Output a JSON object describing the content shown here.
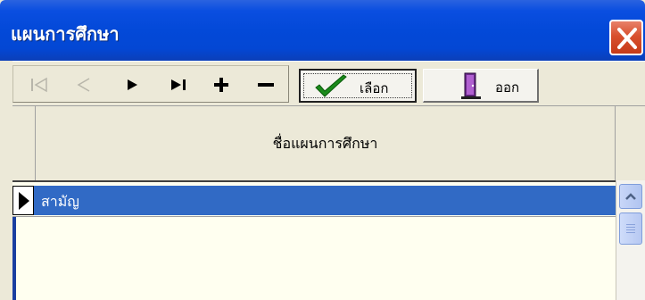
{
  "window": {
    "title": "แผนการศึกษา"
  },
  "toolbar": {
    "nav_buttons": [
      {
        "name": "first-record",
        "enabled": false
      },
      {
        "name": "prior-record",
        "enabled": false
      },
      {
        "name": "next-record",
        "enabled": true
      },
      {
        "name": "last-record",
        "enabled": true
      },
      {
        "name": "insert-record",
        "enabled": true
      },
      {
        "name": "delete-record",
        "enabled": true
      }
    ],
    "select_label": "เลือก",
    "exit_label": "ออก"
  },
  "grid": {
    "columns": [
      "ชื่อแผนการศึกษา"
    ],
    "rows": [
      {
        "name": "สามัญ",
        "selected": true
      }
    ]
  },
  "colors": {
    "titlebar": "#0349d8",
    "selection": "#316ac5",
    "grid_bg": "#fffff0",
    "close": "#d8502e"
  }
}
